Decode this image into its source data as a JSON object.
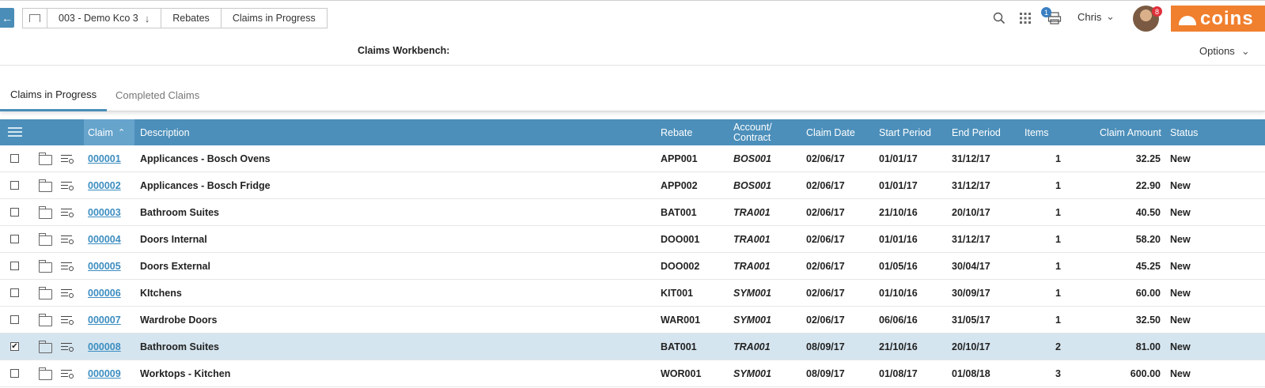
{
  "breadcrumbs": [
    {
      "label": "003 - Demo Kco 3",
      "chevron": "↓"
    },
    {
      "label": "Rebates"
    },
    {
      "label": "Claims in Progress"
    }
  ],
  "header": {
    "printer_badge": "1",
    "avatar_badge": "8",
    "user_name": "Chris",
    "logo_text": "coins"
  },
  "workbench": {
    "title": "Claims Workbench:",
    "options_label": "Options"
  },
  "tabs": [
    {
      "label": "Claims in Progress",
      "active": true
    },
    {
      "label": "Completed Claims",
      "active": false
    }
  ],
  "table": {
    "columns": {
      "claim": "Claim",
      "description": "Description",
      "rebate": "Rebate",
      "account_line1": "Account/",
      "account_line2": "Contract",
      "claim_date": "Claim Date",
      "start_period": "Start Period",
      "end_period": "End Period",
      "items": "Items",
      "claim_amount": "Claim Amount",
      "status": "Status"
    },
    "rows": [
      {
        "checked": false,
        "claim": "000001",
        "description": "Applicances - Bosch Ovens",
        "rebate": "APP001",
        "account": "BOS001",
        "claim_date": "02/06/17",
        "start_period": "01/01/17",
        "end_period": "31/12/17",
        "items": "1",
        "claim_amount": "32.25",
        "status": "New"
      },
      {
        "checked": false,
        "claim": "000002",
        "description": "Applicances - Bosch Fridge",
        "rebate": "APP002",
        "account": "BOS001",
        "claim_date": "02/06/17",
        "start_period": "01/01/17",
        "end_period": "31/12/17",
        "items": "1",
        "claim_amount": "22.90",
        "status": "New"
      },
      {
        "checked": false,
        "claim": "000003",
        "description": "Bathroom Suites",
        "rebate": "BAT001",
        "account": "TRA001",
        "claim_date": "02/06/17",
        "start_period": "21/10/16",
        "end_period": "20/10/17",
        "items": "1",
        "claim_amount": "40.50",
        "status": "New"
      },
      {
        "checked": false,
        "claim": "000004",
        "description": "Doors Internal",
        "rebate": "DOO001",
        "account": "TRA001",
        "claim_date": "02/06/17",
        "start_period": "01/01/16",
        "end_period": "31/12/17",
        "items": "1",
        "claim_amount": "58.20",
        "status": "New"
      },
      {
        "checked": false,
        "claim": "000005",
        "description": "Doors External",
        "rebate": "DOO002",
        "account": "TRA001",
        "claim_date": "02/06/17",
        "start_period": "01/05/16",
        "end_period": "30/04/17",
        "items": "1",
        "claim_amount": "45.25",
        "status": "New"
      },
      {
        "checked": false,
        "claim": "000006",
        "description": "KItchens",
        "rebate": "KIT001",
        "account": "SYM001",
        "claim_date": "02/06/17",
        "start_period": "01/10/16",
        "end_period": "30/09/17",
        "items": "1",
        "claim_amount": "60.00",
        "status": "New"
      },
      {
        "checked": false,
        "claim": "000007",
        "description": "Wardrobe Doors",
        "rebate": "WAR001",
        "account": "SYM001",
        "claim_date": "02/06/17",
        "start_period": "06/06/16",
        "end_period": "31/05/17",
        "items": "1",
        "claim_amount": "32.50",
        "status": "New"
      },
      {
        "checked": true,
        "claim": "000008",
        "description": "Bathroom Suites",
        "rebate": "BAT001",
        "account": "TRA001",
        "claim_date": "08/09/17",
        "start_period": "21/10/16",
        "end_period": "20/10/17",
        "items": "2",
        "claim_amount": "81.00",
        "status": "New"
      },
      {
        "checked": false,
        "claim": "000009",
        "description": "Worktops - Kitchen",
        "rebate": "WOR001",
        "account": "SYM001",
        "claim_date": "08/09/17",
        "start_period": "01/08/17",
        "end_period": "01/08/18",
        "items": "3",
        "claim_amount": "600.00",
        "status": "New"
      }
    ]
  },
  "colors": {
    "accent": "#4c8fba",
    "link": "#3c8dc0",
    "brand": "#f07f2e",
    "badge_blue": "#3a7fc1",
    "badge_red": "#e0303a",
    "selected_row": "#d5e5ef"
  },
  "icons": [
    "back-arrow-icon",
    "home-icon",
    "chevron-down-icon",
    "search-icon",
    "apps-grid-icon",
    "printer-icon",
    "list-menu-icon",
    "sort-up-icon",
    "checkbox-icon",
    "folder-icon",
    "details-icon"
  ]
}
